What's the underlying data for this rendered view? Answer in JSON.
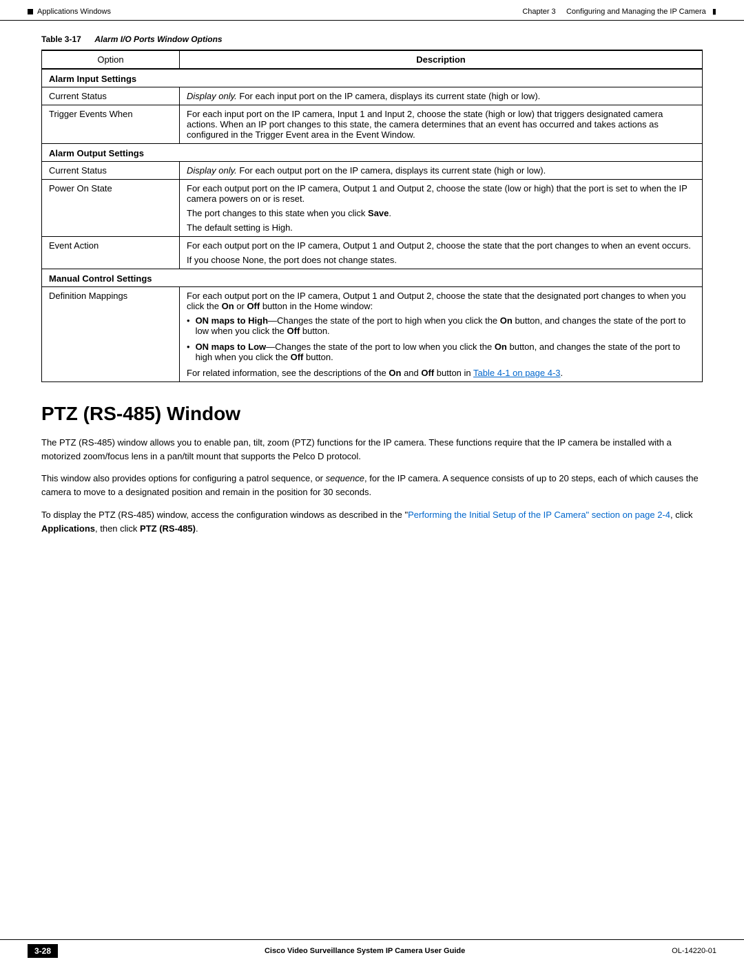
{
  "header": {
    "chapter": "Chapter 3",
    "title": "Configuring and Managing the IP Camera",
    "section": "Applications Windows"
  },
  "table": {
    "number": "Table 3-17",
    "caption": "Alarm I/O Ports Window Options",
    "col_option": "Option",
    "col_description": "Description",
    "sections": [
      {
        "name": "Alarm Input Settings",
        "rows": [
          {
            "option": "Current Status",
            "desc_parts": [
              {
                "type": "italic",
                "text": "Display only."
              },
              {
                "type": "normal",
                "text": " For each input port on the IP camera, displays its current state (high or low)."
              }
            ]
          },
          {
            "option": "Trigger Events When",
            "desc_parts": [
              {
                "type": "normal",
                "text": "For each input port on the IP camera, Input 1 and Input 2, choose the state (high or low) that triggers designated camera actions. When an IP port changes to this state, the camera determines that an event has occurred and takes actions as configured in the Trigger Event area in the Event Window."
              }
            ]
          }
        ]
      },
      {
        "name": "Alarm Output Settings",
        "rows": [
          {
            "option": "Current Status",
            "desc_parts": [
              {
                "type": "italic",
                "text": "Display only."
              },
              {
                "type": "normal",
                "text": " For each output port on the IP camera, displays its current state (high or low)."
              }
            ]
          },
          {
            "option": "Power On State",
            "desc_parts": [
              {
                "type": "normal",
                "text": "For each output port on the IP camera, Output 1 and Output 2, choose the state (low or high) that the port is set to when the IP camera powers on or is reset."
              }
            ],
            "extra_lines": [
              "The port changes to this state when you click Save.",
              "The default setting is High."
            ],
            "bold_word_in_line": "Save"
          },
          {
            "option": "Event Action",
            "desc_parts": [
              {
                "type": "normal",
                "text": "For each output port on the IP camera, Output 1 and Output 2, choose the state that the port changes to when an event occurs."
              }
            ],
            "extra_lines": [
              "If you choose None, the port does not change states."
            ]
          }
        ]
      },
      {
        "name": "Manual Control Settings",
        "rows": [
          {
            "option": "Definition Mappings",
            "desc_parts": [
              {
                "type": "normal",
                "text": "For each output port on the IP camera, Output 1 and Output 2, choose the state that the designated port changes to when you click the "
              },
              {
                "type": "bold",
                "text": "On"
              },
              {
                "type": "normal",
                "text": " or "
              },
              {
                "type": "bold",
                "text": "Off"
              },
              {
                "type": "normal",
                "text": " button in the Home window:"
              }
            ],
            "bullets": [
              {
                "parts": [
                  {
                    "type": "bold",
                    "text": "ON maps to High"
                  },
                  {
                    "type": "normal",
                    "text": "—Changes the state of the port to high when you click the "
                  },
                  {
                    "type": "bold",
                    "text": "On"
                  },
                  {
                    "type": "normal",
                    "text": " button, and changes the state of the port to low when you click the "
                  },
                  {
                    "type": "bold",
                    "text": "Off"
                  },
                  {
                    "type": "normal",
                    "text": " button."
                  }
                ]
              },
              {
                "parts": [
                  {
                    "type": "bold",
                    "text": "ON maps to Low"
                  },
                  {
                    "type": "normal",
                    "text": "—Changes the state of the port to low when you click the "
                  },
                  {
                    "type": "bold",
                    "text": "On"
                  },
                  {
                    "type": "normal",
                    "text": " button, and changes the state of the port to high when you click the "
                  },
                  {
                    "type": "bold",
                    "text": "Off"
                  },
                  {
                    "type": "normal",
                    "text": " button."
                  }
                ]
              }
            ],
            "footer_parts": [
              {
                "type": "normal",
                "text": "For related information, see the descriptions of the "
              },
              {
                "type": "bold",
                "text": "On"
              },
              {
                "type": "normal",
                "text": " and "
              },
              {
                "type": "bold",
                "text": "Off"
              },
              {
                "type": "normal",
                "text": " button in "
              },
              {
                "type": "link",
                "text": "Table 4-1 on page 4-3"
              },
              {
                "type": "normal",
                "text": "."
              }
            ]
          }
        ]
      }
    ]
  },
  "ptz": {
    "title": "PTZ (RS-485) Window",
    "para1": "The PTZ (RS-485) window allows you to enable pan, tilt, zoom (PTZ) functions for the IP camera. These functions require that the IP camera be installed with a motorized zoom/focus lens in a pan/tilt mount that supports the Pelco D protocol.",
    "para2": "This window also provides options for configuring a patrol sequence, or sequence, for the IP camera. A sequence consists of up to 20 steps, each of which causes the camera to move to a designated position and remain in the position for 30 seconds.",
    "para3_prefix": "To display the PTZ (RS-485) window, access the configuration windows as described in the “",
    "para3_link": "Performing the Initial Setup of the IP Camera” section on page 2-4",
    "para3_suffix": ", click Applications, then click PTZ (RS-485).",
    "para3_bold1": "Applications",
    "para3_bold2": "PTZ (RS-485)"
  },
  "footer": {
    "page_num": "3-28",
    "doc_title": "Cisco Video Surveillance System IP Camera User Guide",
    "doc_num": "OL-14220-01"
  }
}
